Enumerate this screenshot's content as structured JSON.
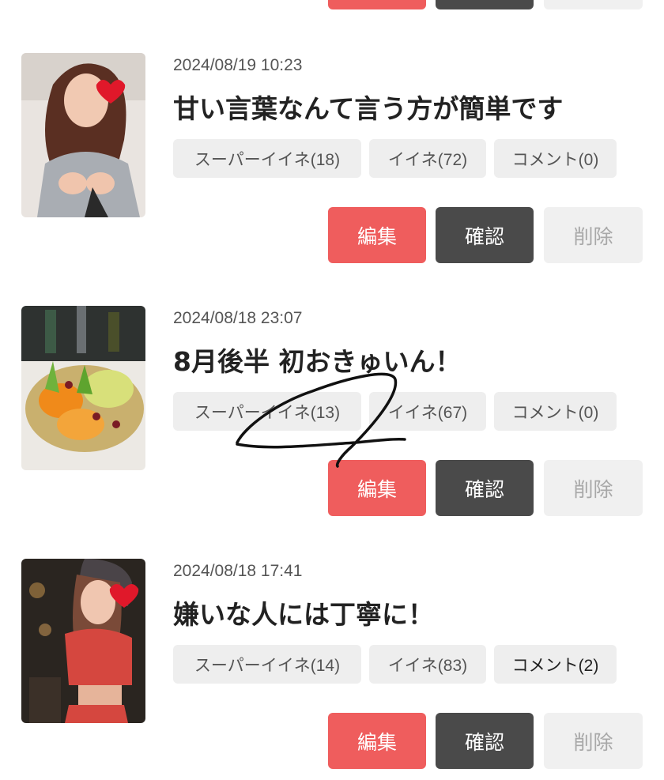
{
  "posts": [
    {
      "date": "2024/08/19 10:23",
      "title": "甘い言葉なんて言う方が簡単です",
      "super_like": "スーパーイイネ(18)",
      "like": "イイネ(72)",
      "comment": "コメント(0)",
      "edit": "編集",
      "confirm": "確認",
      "delete": "削除"
    },
    {
      "date": "2024/08/18 23:07",
      "title": "8月後半 初おきゅいん！",
      "super_like": "スーパーイイネ(13)",
      "like": "イイネ(67)",
      "comment": "コメント(0)",
      "edit": "編集",
      "confirm": "確認",
      "delete": "削除"
    },
    {
      "date": "2024/08/18 17:41",
      "title": "嫌いな人には丁寧に！",
      "super_like": "スーパーイイネ(14)",
      "like": "イイネ(83)",
      "comment": "コメント(2)",
      "edit": "編集",
      "confirm": "確認",
      "delete": "削除"
    }
  ],
  "colors": {
    "edit_button": "#ef5d5d",
    "confirm_button": "#4a4a4a",
    "delete_button": "#f0f0f0",
    "tag_background": "#eeeeee"
  }
}
